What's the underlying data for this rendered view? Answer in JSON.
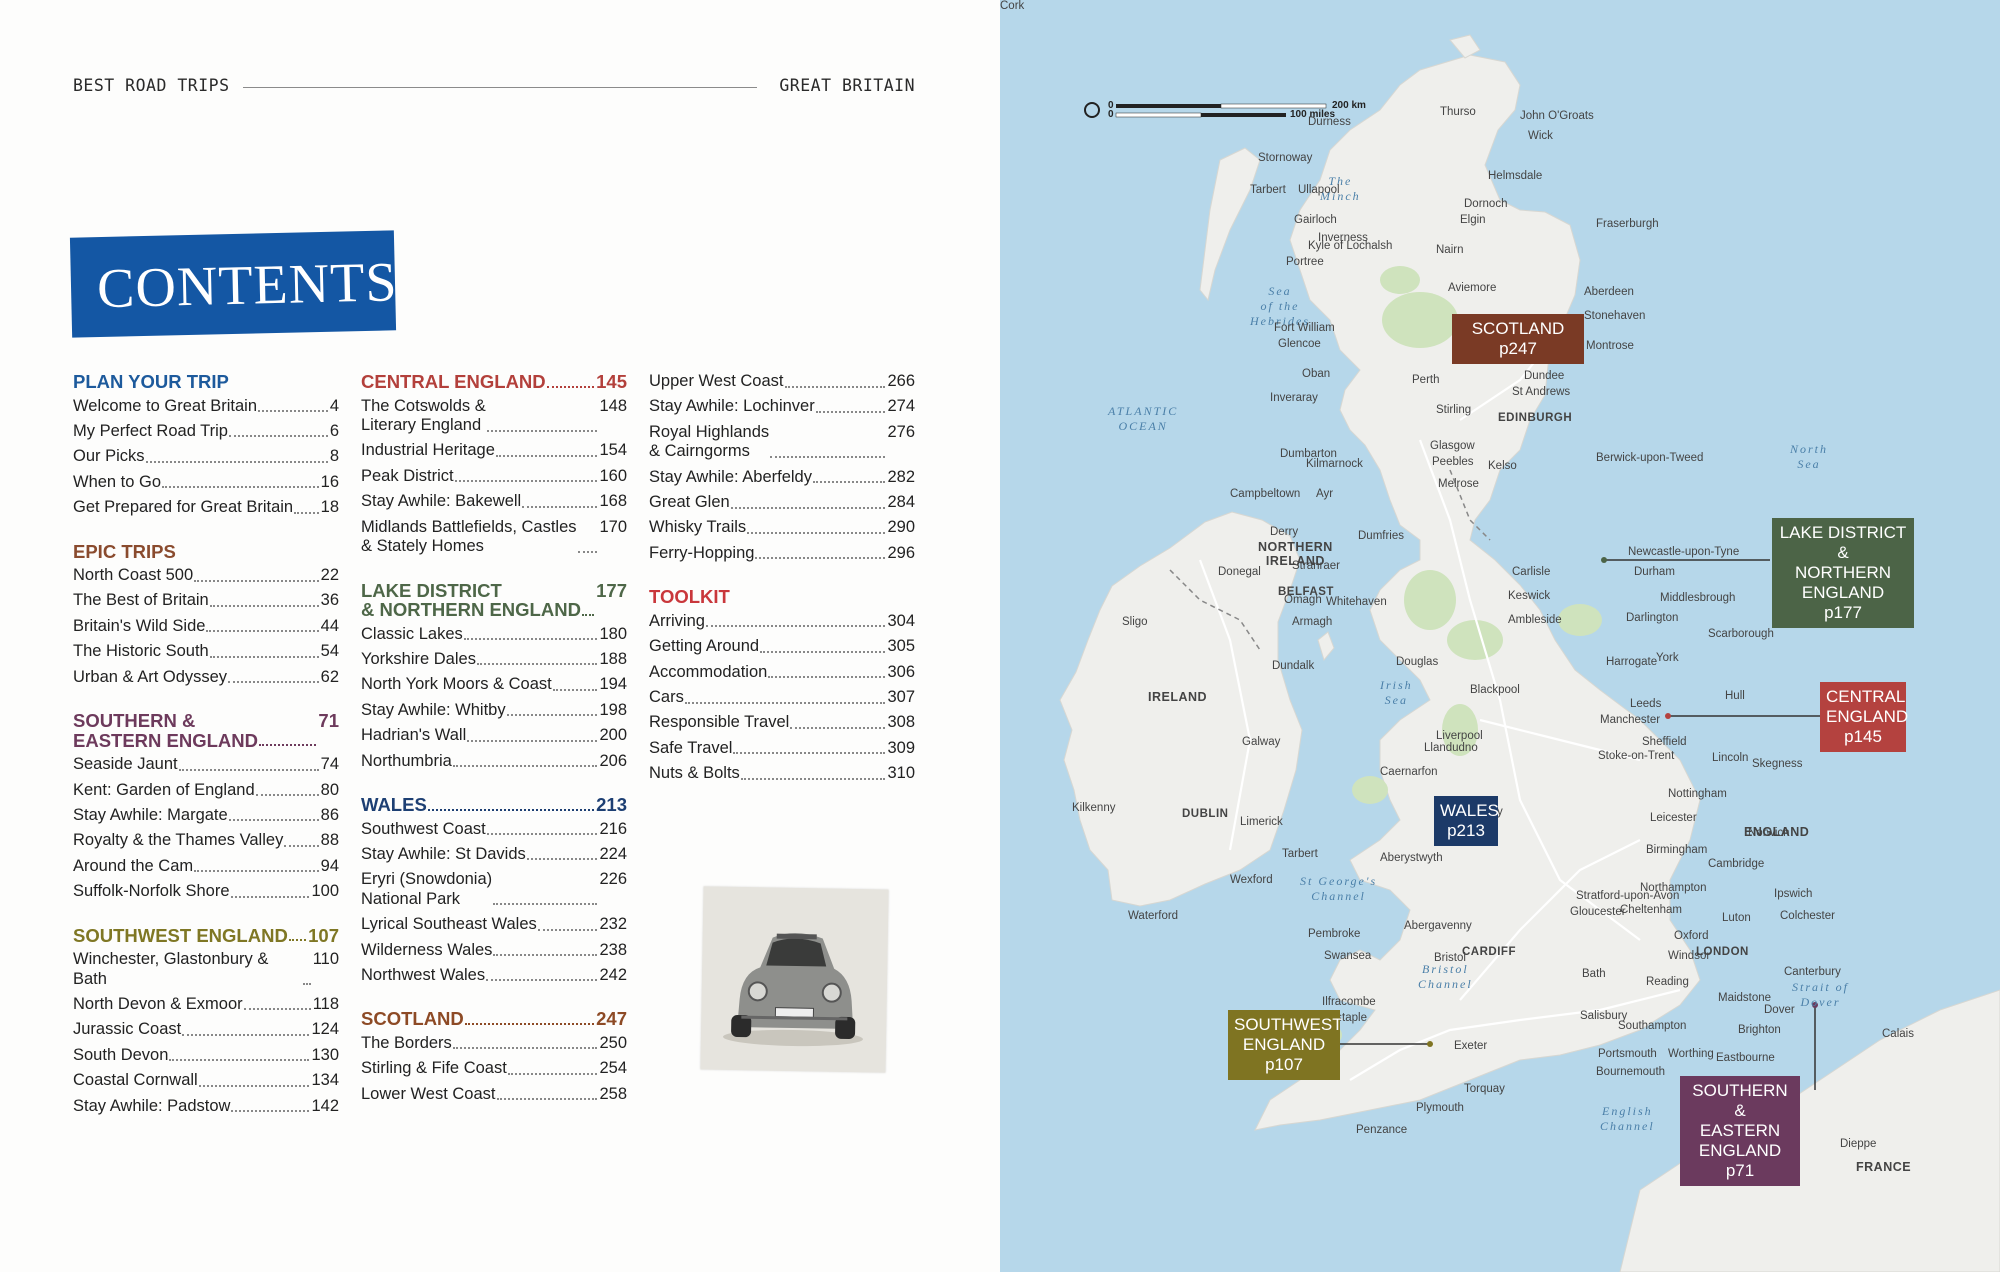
{
  "header": {
    "left": "BEST ROAD TRIPS",
    "right": "GREAT BRITAIN"
  },
  "banner": {
    "title": "CONTENTS",
    "color": "#1457a4"
  },
  "columns": [
    {
      "sections": [
        {
          "title": "PLAN YOUR TRIP",
          "page": "",
          "color": "c-blue",
          "entries": [
            {
              "t": "Welcome to Great Britain",
              "p": "4"
            },
            {
              "t": "My Perfect Road Trip",
              "p": "6"
            },
            {
              "t": "Our Picks",
              "p": "8"
            },
            {
              "t": "When to Go",
              "p": "16"
            },
            {
              "t": "Get Prepared for Great Britain",
              "p": "18"
            }
          ]
        },
        {
          "title": "EPIC TRIPS",
          "page": "",
          "color": "c-brown",
          "entries": [
            {
              "t": "North Coast 500",
              "p": "22"
            },
            {
              "t": "The Best of Britain",
              "p": "36"
            },
            {
              "t": "Britain's Wild Side",
              "p": "44"
            },
            {
              "t": "The Historic South",
              "p": "54"
            },
            {
              "t": "Urban & Art Odyssey",
              "p": "62"
            }
          ]
        },
        {
          "title": "SOUTHERN &\nEASTERN ENGLAND",
          "page": "71",
          "color": "c-purple",
          "entries": [
            {
              "t": "Seaside Jaunt",
              "p": "74"
            },
            {
              "t": "Kent: Garden of England",
              "p": "80"
            },
            {
              "t": "Stay Awhile: Margate",
              "p": "86"
            },
            {
              "t": "Royalty & the Thames Valley",
              "p": "88"
            },
            {
              "t": "Around the Cam",
              "p": "94"
            },
            {
              "t": "Suffolk-Norfolk Shore",
              "p": "100"
            }
          ]
        },
        {
          "title": "SOUTHWEST ENGLAND",
          "page": "107",
          "color": "c-olive",
          "entries": [
            {
              "t": "Winchester, Glastonbury & Bath",
              "p": "110"
            },
            {
              "t": "North Devon & Exmoor",
              "p": "118"
            },
            {
              "t": "Jurassic Coast",
              "p": "124"
            },
            {
              "t": "South Devon",
              "p": "130"
            },
            {
              "t": "Coastal Cornwall",
              "p": "134"
            },
            {
              "t": "Stay Awhile: Padstow",
              "p": "142"
            }
          ]
        }
      ]
    },
    {
      "sections": [
        {
          "title": "CENTRAL ENGLAND",
          "page": "145",
          "color": "c-red",
          "entries": [
            {
              "t": "The Cotswolds &\nLiterary England",
              "p": "148"
            },
            {
              "t": "Industrial Heritage",
              "p": "154"
            },
            {
              "t": "Peak District",
              "p": "160"
            },
            {
              "t": "Stay Awhile: Bakewell",
              "p": "168"
            },
            {
              "t": "Midlands Battlefields, Castles\n& Stately Homes",
              "p": "170"
            }
          ]
        },
        {
          "title": "LAKE DISTRICT\n& NORTHERN ENGLAND",
          "page": "177",
          "color": "c-green",
          "entries": [
            {
              "t": "Classic Lakes",
              "p": "180"
            },
            {
              "t": "Yorkshire Dales",
              "p": "188"
            },
            {
              "t": "North York Moors & Coast",
              "p": "194"
            },
            {
              "t": "Stay Awhile: Whitby",
              "p": "198"
            },
            {
              "t": "Hadrian's Wall",
              "p": "200"
            },
            {
              "t": "Northumbria",
              "p": "206"
            }
          ]
        },
        {
          "title": "WALES",
          "page": "213",
          "color": "c-navy",
          "entries": [
            {
              "t": "Southwest Coast",
              "p": "216"
            },
            {
              "t": "Stay Awhile: St Davids",
              "p": "224"
            },
            {
              "t": "Eryri (Snowdonia)\nNational Park",
              "p": "226"
            },
            {
              "t": "Lyrical Southeast Wales",
              "p": "232"
            },
            {
              "t": "Wilderness Wales",
              "p": "238"
            },
            {
              "t": "Northwest Wales",
              "p": "242"
            }
          ]
        },
        {
          "title": "SCOTLAND",
          "page": "247",
          "color": "c-rust",
          "entries": [
            {
              "t": "The Borders",
              "p": "250"
            },
            {
              "t": "Stirling & Fife Coast",
              "p": "254"
            },
            {
              "t": "Lower West Coast",
              "p": "258"
            }
          ]
        }
      ]
    },
    {
      "sections": [
        {
          "title": "",
          "page": "",
          "color": "c-rust",
          "entries": [
            {
              "t": "Upper West Coast",
              "p": "266"
            },
            {
              "t": "Stay Awhile: Lochinver",
              "p": "274"
            },
            {
              "t": "Royal Highlands\n& Cairngorms",
              "p": "276"
            },
            {
              "t": "Stay Awhile: Aberfeldy",
              "p": "282"
            },
            {
              "t": "Great Glen",
              "p": "284"
            },
            {
              "t": "Whisky Trails",
              "p": "290"
            },
            {
              "t": "Ferry-Hopping",
              "p": "296"
            }
          ]
        },
        {
          "title": "TOOLKIT",
          "page": "",
          "color": "c-tool",
          "entries": [
            {
              "t": "Arriving",
              "p": "304"
            },
            {
              "t": "Getting Around",
              "p": "305"
            },
            {
              "t": "Accommodation",
              "p": "306"
            },
            {
              "t": "Cars",
              "p": "307"
            },
            {
              "t": "Responsible Travel",
              "p": "308"
            },
            {
              "t": "Safe Travel",
              "p": "309"
            },
            {
              "t": "Nuts & Bolts",
              "p": "310"
            }
          ]
        }
      ]
    }
  ],
  "map": {
    "colors": {
      "sea": "#b6d7ea",
      "land": "#f0f0ee",
      "park": "#cfe3bd"
    },
    "scale": {
      "km": "200 km",
      "miles": "100 miles",
      "zero": "0"
    },
    "seas": [
      {
        "id": "atlantic",
        "text": "ATLANTIC\nOCEAN"
      },
      {
        "id": "northsea",
        "text": "North\nSea"
      },
      {
        "id": "irishsea",
        "text": "Irish\nSea"
      },
      {
        "id": "minch",
        "text": "The\nMinch"
      },
      {
        "id": "hebrides",
        "text": "Sea\nof the\nHebrides"
      },
      {
        "id": "channel",
        "text": "English\nChannel"
      },
      {
        "id": "bristol",
        "text": "Bristol\nChannel"
      },
      {
        "id": "georges",
        "text": "St George's\nChannel"
      },
      {
        "id": "dover",
        "text": "Strait of\nDover"
      }
    ],
    "countries": [
      {
        "id": "ireland",
        "text": "IRELAND"
      },
      {
        "id": "ni",
        "text": "NORTHERN\nIRELAND"
      },
      {
        "id": "england",
        "text": "ENGLAND"
      },
      {
        "id": "france",
        "text": "FRANCE"
      }
    ],
    "cities": [
      "Thurso",
      "John O'Groats",
      "Wick",
      "Durness",
      "Stornoway",
      "Tarbert",
      "Ullapool",
      "Dornoch",
      "Helmsdale",
      "Gairloch",
      "Inverness",
      "Nairn",
      "Elgin",
      "Fraserburgh",
      "Portree",
      "Kyle of Lochalsh",
      "Aviemore",
      "Aberdeen",
      "Stonehaven",
      "Fort William",
      "Glencoe",
      "Montrose",
      "Oban",
      "Perth",
      "Dundee",
      "St Andrews",
      "Inveraray",
      "Stirling",
      "EDINBURGH",
      "Glasgow",
      "Dumbarton",
      "Kilmarnock",
      "Ayr",
      "Berwick-upon-Tweed",
      "Peebles",
      "Melrose",
      "Kelso",
      "Campbeltown",
      "Stranraer",
      "Dumfries",
      "Carlisle",
      "Newcastle-upon-Tyne",
      "Durham",
      "Middlesbrough",
      "Keswick",
      "Ambleside",
      "Darlington",
      "Scarborough",
      "Whitehaven",
      "Harrogate",
      "York",
      "Douglas",
      "Blackpool",
      "Leeds",
      "Hull",
      "Manchester",
      "Sheffield",
      "Liverpool",
      "Llandudno",
      "Caernarfon",
      "Lincoln",
      "Skegness",
      "Stoke-on-Trent",
      "Nottingham",
      "Shrewsbury",
      "Leicester",
      "Aberystwyth",
      "Birmingham",
      "Norwich",
      "Cambridge",
      "Northampton",
      "Ipswich",
      "Stratford-upon-Avon",
      "Gloucester",
      "Cheltenham",
      "Oxford",
      "Luton",
      "Colchester",
      "Pembroke",
      "Abergavenny",
      "Swansea",
      "CARDIFF",
      "Bristol",
      "Windsor",
      "LONDON",
      "Bath",
      "Reading",
      "Canterbury",
      "Ilfracombe",
      "Barnstaple",
      "Maidstone",
      "Salisbury",
      "Southampton",
      "Brighton",
      "Dover",
      "Exeter",
      "Portsmouth",
      "Worthing",
      "Eastbourne",
      "Bournemouth",
      "Torquay",
      "Plymouth",
      "Penzance",
      "Calais",
      "Dieppe",
      "Derry",
      "Donegal",
      "Omagh",
      "BELFAST",
      "Armagh",
      "Sligo",
      "Dundalk",
      "Galway",
      "DUBLIN",
      "Limerick",
      "Kilkenny",
      "Tarbert ",
      "Wexford",
      "Waterford",
      "Cork"
    ],
    "regions": [
      {
        "id": "scotland",
        "name": "SCOTLAND\np247",
        "color": "#7a3a25"
      },
      {
        "id": "lake",
        "name": "LAKE DISTRICT &\nNORTHERN\nENGLAND\np177",
        "color": "#4c6447"
      },
      {
        "id": "central",
        "name": "CENTRAL\nENGLAND\np145",
        "color": "#b4423f"
      },
      {
        "id": "wales",
        "name": "WALES\np213",
        "color": "#1c3a68"
      },
      {
        "id": "southwest",
        "name": "SOUTHWEST\nENGLAND\np107",
        "color": "#7f7422"
      },
      {
        "id": "southern",
        "name": "SOUTHERN &\nEASTERN\nENGLAND\np71",
        "color": "#6b3a5e"
      }
    ]
  }
}
